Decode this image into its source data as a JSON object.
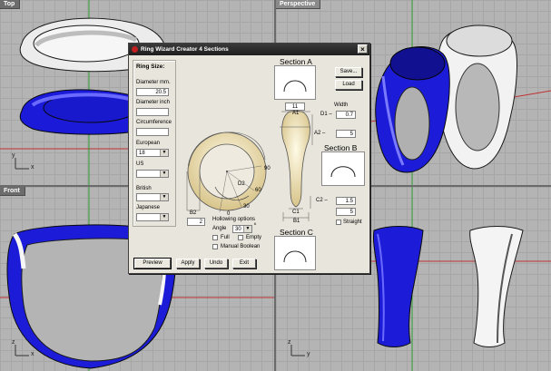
{
  "viewports": {
    "top": {
      "title": "Top"
    },
    "perspective": {
      "title": "Perspective"
    },
    "front": {
      "title": "Front"
    },
    "right": {
      "title": ""
    }
  },
  "axes": {
    "x": "x",
    "y": "y",
    "z": "z"
  },
  "dialog": {
    "title": "Ring Wizard Creator 4 Sections",
    "close": "×",
    "ring_size": "Ring Size:",
    "diameter_mm_label": "Diameter mm.",
    "diameter_mm_value": "20.5",
    "diameter_inch_label": "Diameter inch",
    "diameter_inch_value": "",
    "circumference_label": "Circumference",
    "circumference_value": "",
    "european_label": "European",
    "european_value": "18",
    "us_label": "US",
    "us_value": "",
    "british_label": "British",
    "british_value": "",
    "japanese_label": "Japanese",
    "japanese_value": "",
    "section_a": "Section A",
    "section_b": "Section B",
    "section_c": "Section C",
    "save": "Save...",
    "load": "Load",
    "a1_value": "11",
    "width_label": "Width",
    "a1_label": "A1",
    "d1_label": "D1 –",
    "d1_value": "0.7",
    "a2_label": "A2 –",
    "a2_value": "5",
    "c2_label": "C2 –",
    "c2_value": "1.5",
    "c1_value": "5",
    "c1_label": "C1",
    "b1_label": "B1",
    "straight": "Straight",
    "d2_label": "D2",
    "b2_label": "B2",
    "b2_value": "2",
    "deg_90": "90",
    "deg_60": "60",
    "deg_30": "30",
    "deg_0": "0",
    "hollowing": "Hollowing options",
    "angle_label": "Angle",
    "angle_value": "30",
    "deg_sign": "º",
    "full": "Full",
    "empty": "Empty",
    "manual_boolean": "Manual Boolean",
    "preview": "Preview",
    "apply": "Apply",
    "undo": "Undo",
    "exit": "Exit"
  }
}
